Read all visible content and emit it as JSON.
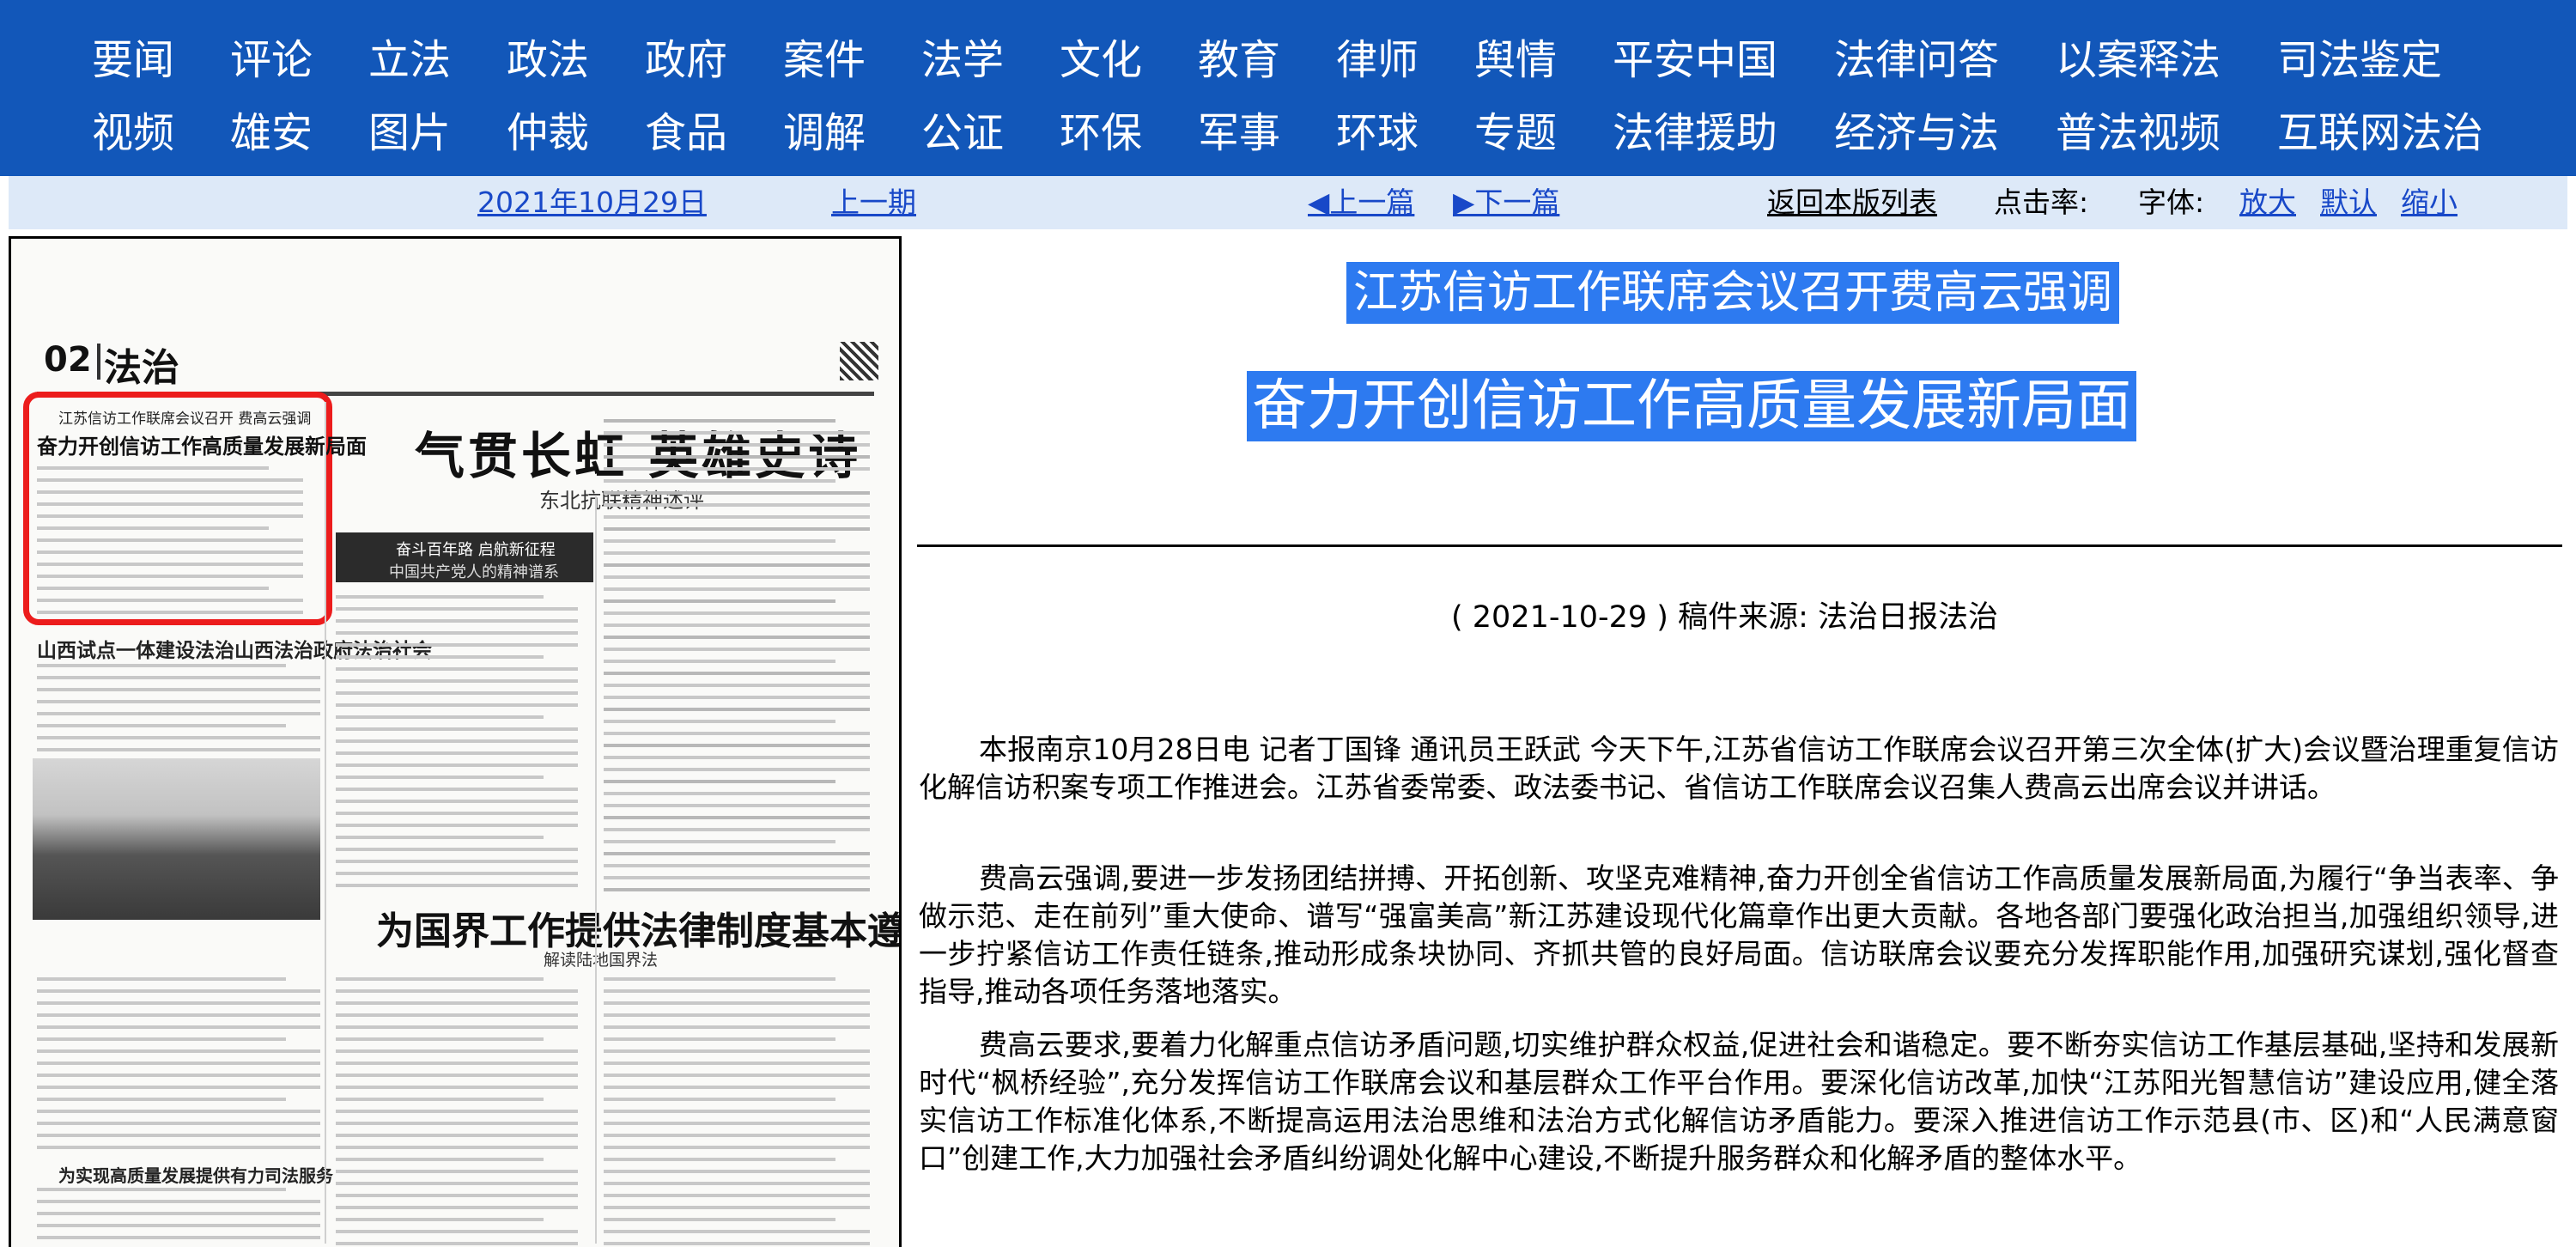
{
  "nav": {
    "row1": [
      "要闻",
      "评论",
      "立法",
      "政法",
      "政府",
      "案件",
      "法学",
      "文化",
      "教育",
      "律师",
      "舆情",
      "平安中国",
      "法律问答",
      "以案释法",
      "司法鉴定"
    ],
    "row2": [
      "视频",
      "雄安",
      "图片",
      "仲裁",
      "食品",
      "调解",
      "公证",
      "环保",
      "军事",
      "环球",
      "专题",
      "法律援助",
      "经济与法",
      "普法视频",
      "互联网法治"
    ]
  },
  "subbar": {
    "date": "2021年10月29日",
    "prev_issue": "上一期",
    "prev_article": "◀上一篇",
    "next_article": "▶下一篇",
    "back_list": "返回本版列表",
    "clicks_label": "点击率:",
    "font_label": "字体:",
    "font_larger": "放大",
    "font_default": "默认",
    "font_smaller": "缩小"
  },
  "newspaper": {
    "page_number": "02",
    "page_name": "法治",
    "headline": "气贯长虹 英雄史诗",
    "headline_sub": "东北抗联精神述评",
    "highlight_small": "江苏信访工作联席会议召开 费高云强调",
    "highlight_title": "奋力开创信访工作高质量发展新局面",
    "banner_line1": "奋斗百年路 启航新征程",
    "banner_line2": "中国共产党人的精神谱系",
    "article2_title": "山西试点一体建设法治山西法治政府法治社会",
    "article3_title": "为国界工作提供法律制度基本遵循",
    "article3_sub": "解读陆地国界法",
    "article4_title": "为实现高质量发展提供有力司法服务"
  },
  "article": {
    "title1": "江苏信访工作联席会议召开费高云强调",
    "title2": "奋力开创信访工作高质量发展新局面",
    "meta": "( 2021-10-29 )  稿件来源:  法治日报法治",
    "paragraphs": [
      "本报南京10月28日电 记者丁国锋 通讯员王跃武 今天下午,江苏省信访工作联席会议召开第三次全体(扩大)会议暨治理重复信访化解信访积案专项工作推进会。江苏省委常委、政法委书记、省信访工作联席会议召集人费高云出席会议并讲话。",
      "费高云强调,要进一步发扬团结拼搏、开拓创新、攻坚克难精神,奋力开创全省信访工作高质量发展新局面,为履行“争当表率、争做示范、走在前列”重大使命、谱写“强富美高”新江苏建设现代化篇章作出更大贡献。各地各部门要强化政治担当,加强组织领导,进一步拧紧信访工作责任链条,推动形成条块协同、齐抓共管的良好局面。信访联席会议要充分发挥职能作用,加强研究谋划,强化督查指导,推动各项任务落地落实。",
      "费高云要求,要着力化解重点信访矛盾问题,切实维护群众权益,促进社会和谐稳定。要不断夯实信访工作基层基础,坚持和发展新时代“枫桥经验”,充分发挥信访工作联席会议和基层群众工作平台作用。要深化信访改革,加快“江苏阳光智慧信访”建设应用,健全落实信访工作标准化体系,不断提高运用法治思维和法治方式化解信访矛盾能力。要深入推进信访工作示范县(市、区)和“人民满意窗口”创建工作,大力加强社会矛盾纠纷调处化解中心建设,不断提升服务群众和化解矛盾的整体水平。"
    ]
  },
  "colors": {
    "nav_bg": "#1257b9",
    "subbar_bg": "#dde9f8",
    "link": "#1848c8",
    "title_highlight": "#2d7af0",
    "highlight_box": "#ec1c1c"
  }
}
